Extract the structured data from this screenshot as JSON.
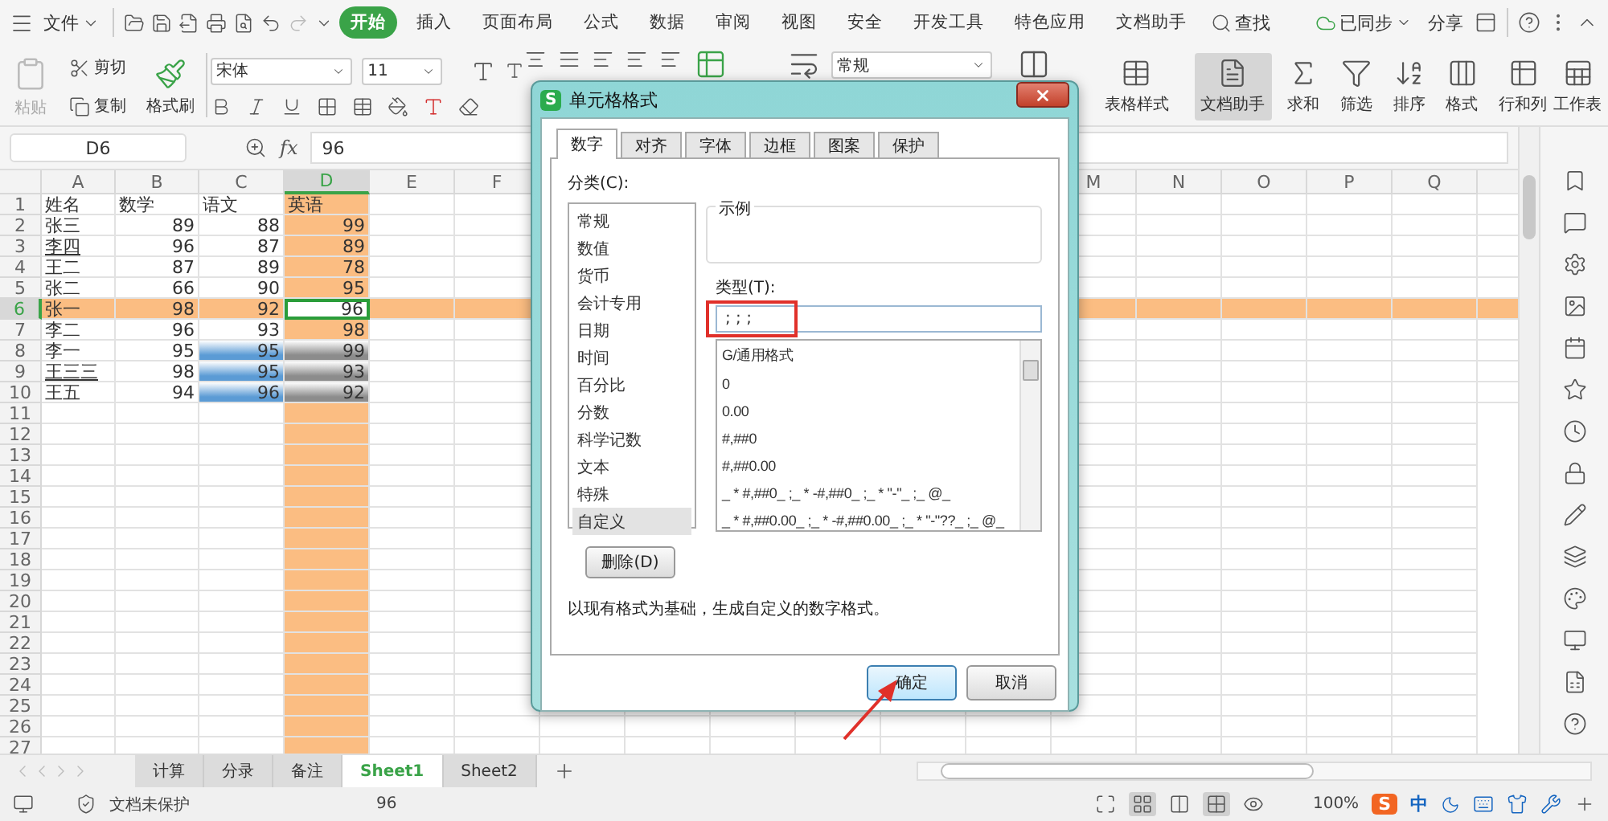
{
  "menu_bar": {
    "file": "文件",
    "tabs": [
      {
        "label": "开始",
        "selected": true
      },
      {
        "label": "插入",
        "selected": false
      },
      {
        "label": "页面布局",
        "selected": false
      },
      {
        "label": "公式",
        "selected": false
      },
      {
        "label": "数据",
        "selected": false
      },
      {
        "label": "审阅",
        "selected": false
      },
      {
        "label": "视图",
        "selected": false
      },
      {
        "label": "安全",
        "selected": false
      },
      {
        "label": "开发工具",
        "selected": false
      },
      {
        "label": "特色应用",
        "selected": false
      },
      {
        "label": "文档助手",
        "selected": false
      }
    ],
    "search": "查找",
    "sync": "已同步",
    "share": "分享"
  },
  "ribbon": {
    "paste": {
      "label": "粘贴",
      "disabled": true
    },
    "cut": "剪切",
    "copy": "复制",
    "format_painter": "格式刷",
    "font_name": "宋体",
    "font_size": "11",
    "number_format": "常规",
    "tools": [
      {
        "label": "表格样式",
        "selected": false
      },
      {
        "label": "文档助手",
        "selected": true
      },
      {
        "label": "求和",
        "selected": false
      },
      {
        "label": "筛选",
        "selected": false
      },
      {
        "label": "排序",
        "selected": false
      },
      {
        "label": "格式",
        "selected": false
      },
      {
        "label": "行和列",
        "selected": false
      },
      {
        "label": "工作表",
        "selected": false
      }
    ]
  },
  "formula_bar": {
    "name_box": "D6",
    "fx": "fx",
    "value": "96"
  },
  "sheet": {
    "columns": [
      {
        "label": "A",
        "selected": false
      },
      {
        "label": "B",
        "selected": false
      },
      {
        "label": "C",
        "selected": false
      },
      {
        "label": "D",
        "selected": true
      },
      {
        "label": "E",
        "selected": false
      },
      {
        "label": "F",
        "selected": false
      },
      {
        "label": "M",
        "selected": false
      },
      {
        "label": "N",
        "selected": false
      },
      {
        "label": "O",
        "selected": false
      },
      {
        "label": "P",
        "selected": false
      },
      {
        "label": "Q",
        "selected": false
      }
    ],
    "rows": [
      {
        "label": "1",
        "selected": false,
        "cells": [
          {
            "text": "姓名",
            "kind": "text",
            "active": false,
            "underline": false
          },
          {
            "text": "数学",
            "kind": "text",
            "active": false,
            "underline": false
          },
          {
            "text": "语文",
            "kind": "text",
            "active": false,
            "underline": false
          },
          {
            "text": "英语",
            "kind": "text",
            "active": false,
            "underline": false
          }
        ]
      },
      {
        "label": "2",
        "selected": false,
        "cells": [
          {
            "text": "张三",
            "kind": "text",
            "active": false,
            "underline": false
          },
          {
            "text": "89",
            "kind": "number",
            "active": false,
            "underline": false
          },
          {
            "text": "88",
            "kind": "number",
            "active": false,
            "underline": false
          },
          {
            "text": "99",
            "kind": "number",
            "active": false,
            "underline": false
          }
        ]
      },
      {
        "label": "3",
        "selected": false,
        "cells": [
          {
            "text": "李四",
            "kind": "text",
            "active": false,
            "underline": true
          },
          {
            "text": "96",
            "kind": "number",
            "active": false,
            "underline": false
          },
          {
            "text": "87",
            "kind": "number",
            "active": false,
            "underline": false
          },
          {
            "text": "89",
            "kind": "number",
            "active": false,
            "underline": false
          }
        ]
      },
      {
        "label": "4",
        "selected": false,
        "cells": [
          {
            "text": "王二",
            "kind": "text",
            "active": false,
            "underline": false
          },
          {
            "text": "87",
            "kind": "number",
            "active": false,
            "underline": false
          },
          {
            "text": "89",
            "kind": "number",
            "active": false,
            "underline": false
          },
          {
            "text": "78",
            "kind": "number",
            "active": false,
            "underline": false
          }
        ]
      },
      {
        "label": "5",
        "selected": false,
        "cells": [
          {
            "text": "张二",
            "kind": "text",
            "active": false,
            "underline": false
          },
          {
            "text": "66",
            "kind": "number",
            "active": false,
            "underline": false
          },
          {
            "text": "90",
            "kind": "number",
            "active": false,
            "underline": false
          },
          {
            "text": "95",
            "kind": "number",
            "active": false,
            "underline": false
          }
        ]
      },
      {
        "label": "6",
        "selected": true,
        "cells": [
          {
            "text": "张一",
            "kind": "text",
            "active": false,
            "underline": false
          },
          {
            "text": "98",
            "kind": "number",
            "active": false,
            "underline": false
          },
          {
            "text": "92",
            "kind": "number",
            "active": false,
            "underline": false
          },
          {
            "text": "96",
            "kind": "number",
            "active": true,
            "underline": false
          }
        ]
      },
      {
        "label": "7",
        "selected": false,
        "cells": [
          {
            "text": "李二",
            "kind": "text",
            "active": false,
            "underline": false
          },
          {
            "text": "96",
            "kind": "number",
            "active": false,
            "underline": false
          },
          {
            "text": "93",
            "kind": "number",
            "active": false,
            "underline": false
          },
          {
            "text": "98",
            "kind": "number",
            "active": false,
            "underline": false
          }
        ]
      },
      {
        "label": "8",
        "selected": false,
        "cells": [
          {
            "text": "李一",
            "kind": "text",
            "active": false,
            "underline": false
          },
          {
            "text": "95",
            "kind": "number",
            "active": false,
            "underline": false
          },
          {
            "text": "95",
            "kind": "number",
            "active": false,
            "underline": false,
            "color": "#5b9bd5"
          },
          {
            "text": "99",
            "kind": "number",
            "active": false,
            "underline": false,
            "color": "#8c8c8c"
          }
        ]
      },
      {
        "label": "9",
        "selected": false,
        "cells": [
          {
            "text": "王三三",
            "kind": "text",
            "active": false,
            "underline": true
          },
          {
            "text": "98",
            "kind": "number",
            "active": false,
            "underline": false
          },
          {
            "text": "95",
            "kind": "number",
            "active": false,
            "underline": false,
            "color": "#5b9bd5"
          },
          {
            "text": "93",
            "kind": "number",
            "active": false,
            "underline": false,
            "color": "#8c8c8c"
          }
        ]
      },
      {
        "label": "10",
        "selected": false,
        "cells": [
          {
            "text": "王五",
            "kind": "text",
            "active": false,
            "underline": false
          },
          {
            "text": "94",
            "kind": "number",
            "active": false,
            "underline": false
          },
          {
            "text": "96",
            "kind": "number",
            "active": false,
            "underline": false,
            "color": "#5b9bd5"
          },
          {
            "text": "92",
            "kind": "number",
            "active": false,
            "underline": false,
            "color": "#8c8c8c"
          }
        ]
      }
    ],
    "empty_rows": [
      "11",
      "12",
      "13",
      "14",
      "15",
      "16",
      "17",
      "18",
      "19",
      "20",
      "21",
      "22",
      "23",
      "24",
      "25",
      "26",
      "27"
    ]
  },
  "sheet_tabs": [
    {
      "label": "计算",
      "selected": false
    },
    {
      "label": "分录",
      "selected": false
    },
    {
      "label": "备注",
      "selected": false
    },
    {
      "label": "Sheet1",
      "selected": true
    },
    {
      "label": "Sheet2",
      "selected": false
    }
  ],
  "status_bar": {
    "protection": "文档未保护",
    "value": "96",
    "zoom": "100%",
    "ime_logo": "S",
    "ime_mode": "中"
  },
  "dialog": {
    "icon": "S",
    "title": "单元格格式",
    "tabs": [
      {
        "label": "数字",
        "selected": true
      },
      {
        "label": "对齐",
        "selected": false
      },
      {
        "label": "字体",
        "selected": false
      },
      {
        "label": "边框",
        "selected": false
      },
      {
        "label": "图案",
        "selected": false
      },
      {
        "label": "保护",
        "selected": false
      }
    ],
    "category_label": "分类(C):",
    "categories": [
      {
        "label": "常规",
        "selected": false
      },
      {
        "label": "数值",
        "selected": false
      },
      {
        "label": "货币",
        "selected": false
      },
      {
        "label": "会计专用",
        "selected": false
      },
      {
        "label": "日期",
        "selected": false
      },
      {
        "label": "时间",
        "selected": false
      },
      {
        "label": "百分比",
        "selected": false
      },
      {
        "label": "分数",
        "selected": false
      },
      {
        "label": "科学记数",
        "selected": false
      },
      {
        "label": "文本",
        "selected": false
      },
      {
        "label": "特殊",
        "selected": false
      },
      {
        "label": "自定义",
        "selected": true
      }
    ],
    "example_label": "示例",
    "type_label": "类型(T):",
    "type_value": "; ; ;",
    "formats": [
      "G/通用格式",
      "0",
      "0.00",
      "#,##0",
      "#,##0.00",
      "_ * #,##0_ ;_ * -#,##0_ ;_ * \"-\"_ ;_ @_",
      "_ * #,##0.00_ ;_ * -#,##0.00_ ;_ * \"-\"??_ ;_ @_"
    ],
    "delete_button": "删除(D)",
    "description": "以现有格式为基础，生成自定义的数字格式。",
    "ok": "确定",
    "cancel": "取消"
  }
}
